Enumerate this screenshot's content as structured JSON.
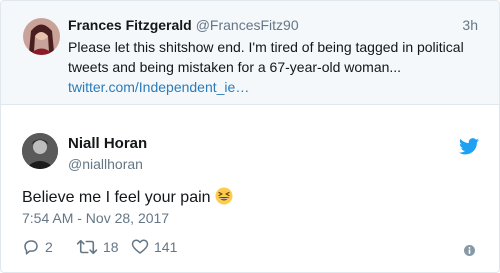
{
  "parent_tweet": {
    "author_name": "Frances Fitzgerald",
    "handle": "@FrancesFitz90",
    "time": "3h",
    "text": "Please let this shitshow end. I'm tired of being tagged in political tweets and being mistaken for a 67-year-old woman...",
    "link": "twitter.com/Independent_ie…"
  },
  "tweet": {
    "author_name": "Niall Horan",
    "handle": "@niallhoran",
    "text": "Believe me I feel your pain",
    "emoji": "grinning-squinting-face",
    "timestamp": "7:54 AM - Nov 28, 2017",
    "replies": "2",
    "retweets": "18",
    "likes": "141"
  },
  "colors": {
    "brand_blue": "#1da1f2",
    "link": "#2b7bb9",
    "muted": "#657786",
    "parent_bg": "#f5f8fa",
    "border": "#e1e8ed"
  }
}
